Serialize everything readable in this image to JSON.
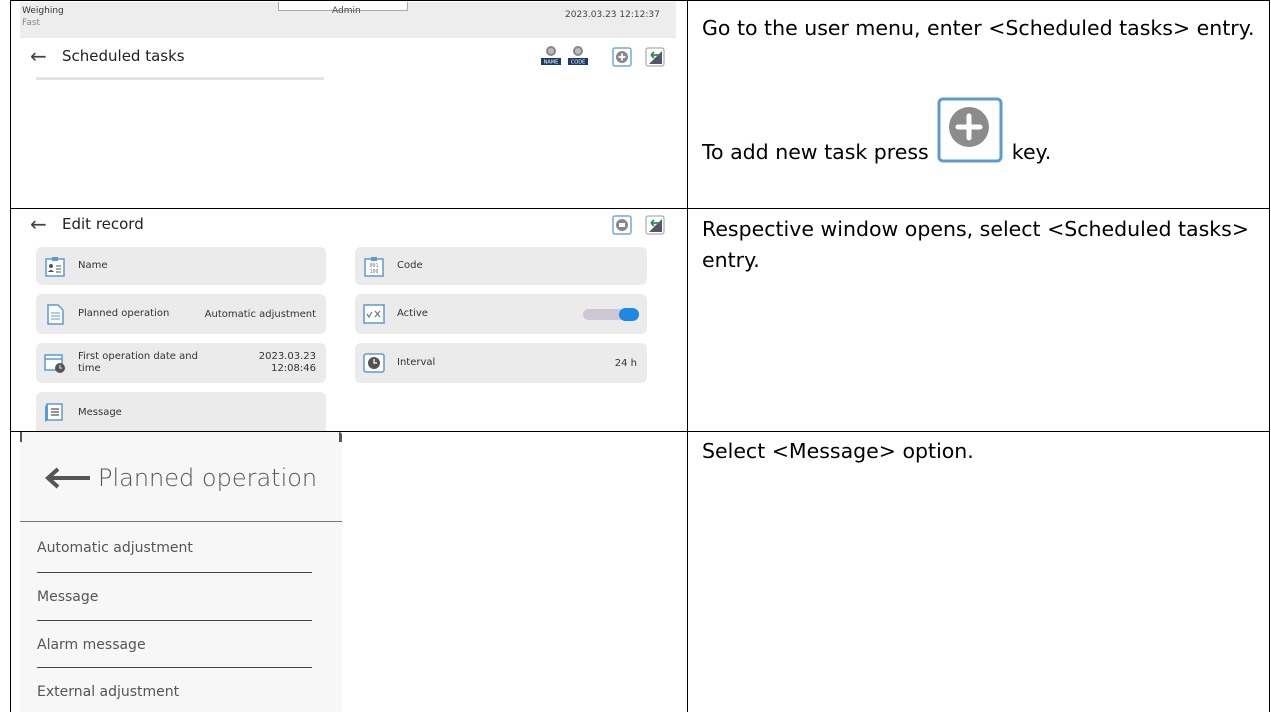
{
  "row1": {
    "status_mode": "Weighing",
    "status_sub": "Fast",
    "status_user": "Admin",
    "status_datetime": "2023.03.23 12:12:37",
    "screen_title": "Scheduled tasks",
    "icons": [
      "search-name-icon",
      "search-code-icon",
      "add-icon",
      "exit-icon"
    ],
    "icon_text_name": "NAME",
    "icon_text_code": "CODE",
    "description_line1": "Go to the user menu, enter <Scheduled tasks> entry.",
    "description_line2_before": "To add new task press",
    "description_line2_after": "key."
  },
  "row2": {
    "screen_title": "Edit record",
    "fields": {
      "name_label": "Name",
      "code_label": "Code",
      "planned_label": "Planned operation",
      "planned_value": "Automatic adjustment",
      "active_label": "Active",
      "active_on": true,
      "first_date_label": "First operation date and time",
      "first_date_value_line1": "2023.03.23",
      "first_date_value_line2": "12:08:46",
      "interval_label": "Interval",
      "interval_value": "24 h",
      "message_label": "Message"
    },
    "description": "Respective window opens, select <Scheduled tasks> entry."
  },
  "row3": {
    "panel_title": "Planned operation",
    "options": [
      "Automatic adjustment",
      "Message",
      "Alarm message",
      "External adjustment"
    ],
    "description": "Select <Message> option."
  },
  "colors": {
    "accent": "#1e88e5",
    "card_bg": "#ebebeb",
    "status_bg": "#ededed"
  }
}
